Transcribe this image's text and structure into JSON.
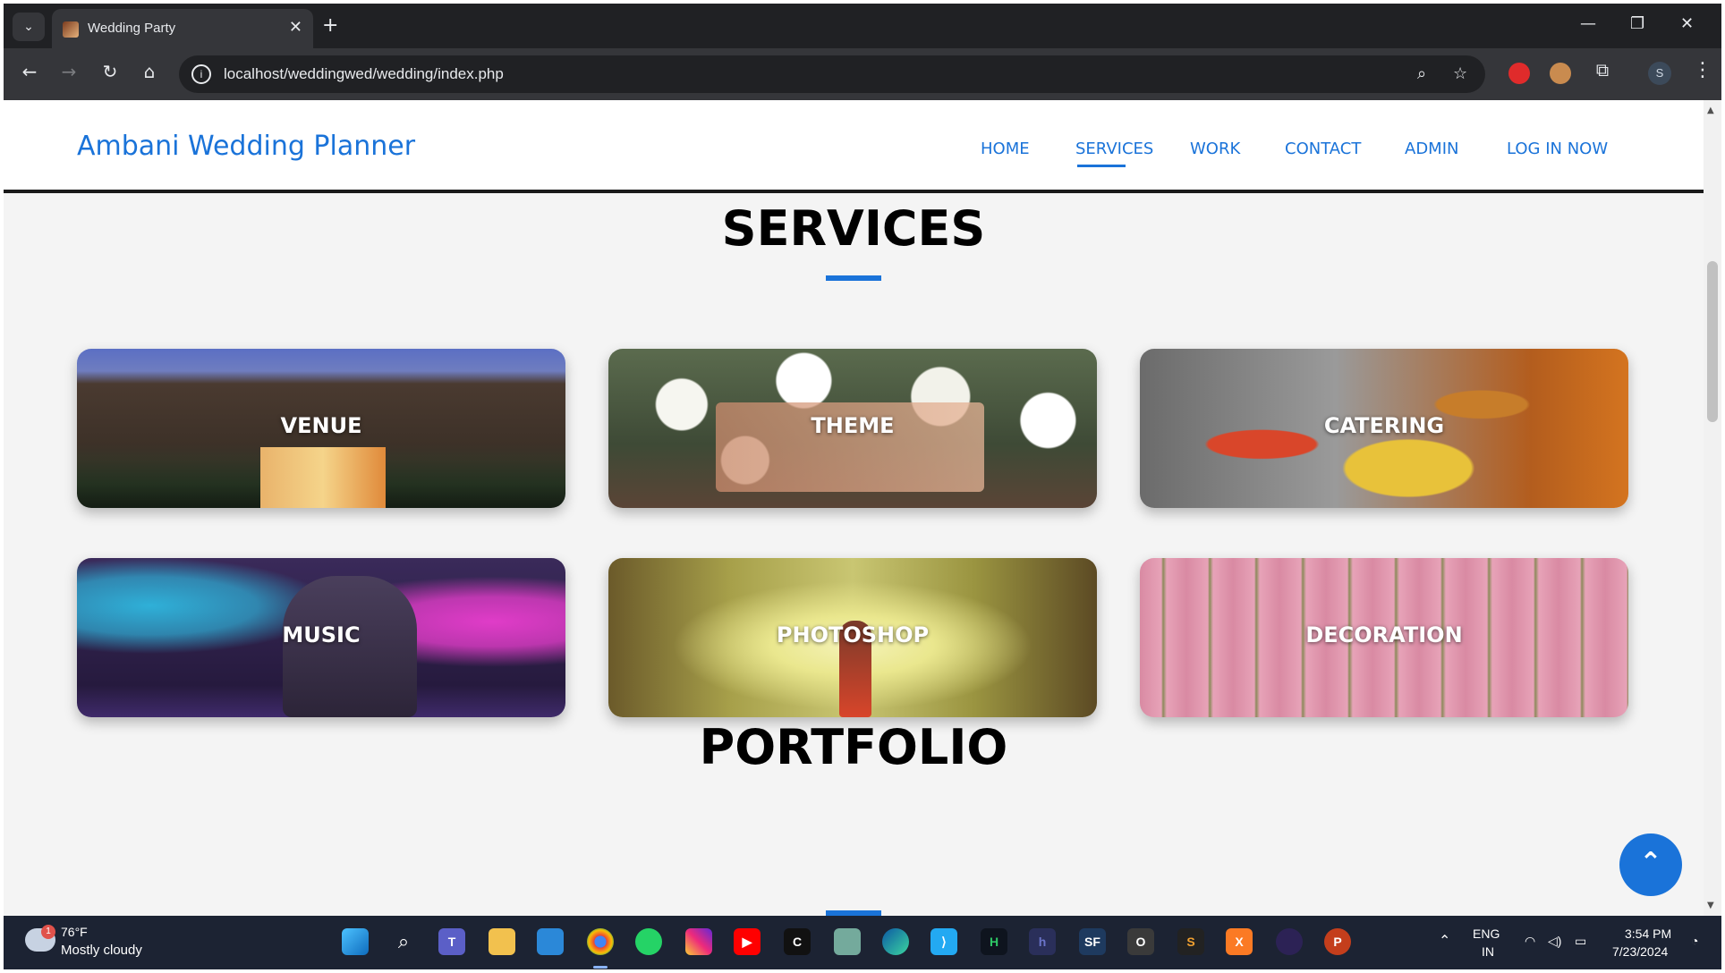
{
  "browser": {
    "tab_title": "Wedding Party",
    "url": "localhost/weddingwed/wedding/index.php",
    "profile_initial": "S"
  },
  "site": {
    "brand": "Ambani Wedding Planner",
    "nav": [
      "HOME",
      "SERVICES",
      "WORK",
      "CONTACT",
      "ADMIN",
      "LOG IN NOW"
    ],
    "active_nav": "SERVICES"
  },
  "services": {
    "title": "SERVICES",
    "items": [
      "VENUE",
      "THEME",
      "CATERING",
      "MUSIC",
      "PHOTOSHOP",
      "DECORATION"
    ]
  },
  "portfolio": {
    "title": "PORTFOLIO"
  },
  "taskbar": {
    "weather_temp": "76°F",
    "weather_desc": "Mostly cloudy",
    "weather_badge": "1",
    "language_line1": "ENG",
    "language_line2": "IN",
    "time": "3:54 PM",
    "date": "7/23/2024"
  },
  "colors": {
    "accent": "#1a73d9",
    "header_border": "#1a1a1a",
    "page_bg": "#f4f4f4"
  }
}
